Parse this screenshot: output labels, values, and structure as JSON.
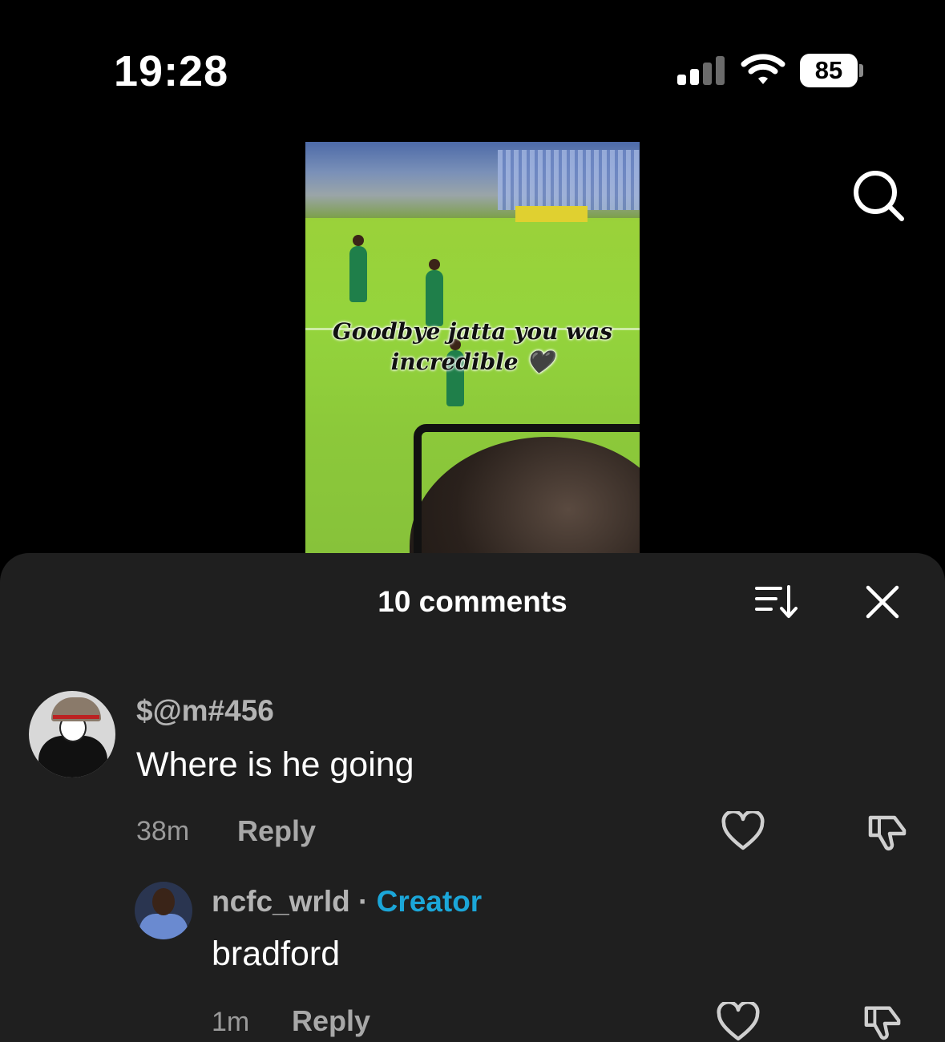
{
  "status_bar": {
    "time": "19:28",
    "battery": "85"
  },
  "video": {
    "caption_line1": "Goodbye jatta you was",
    "caption_line2": "incredible 🖤"
  },
  "comments_panel": {
    "title": "10 comments",
    "comments": [
      {
        "username": "$@m#456",
        "text": "Where is he going",
        "time": "38m",
        "reply_label": "Reply"
      },
      {
        "username": "ncfc_wrld",
        "separator": "·",
        "badge": "Creator",
        "text": "bradford",
        "time": "1m",
        "reply_label": "Reply"
      }
    ]
  },
  "colors": {
    "background": "#000000",
    "sheet": "#1f1f1f",
    "creator_accent": "#1ba6d8",
    "muted_text": "#9a9a9a"
  },
  "icons": [
    "search-icon",
    "sort-icon",
    "close-icon",
    "heart-icon",
    "dislike-icon",
    "signal-icon",
    "wifi-icon",
    "battery-icon"
  ]
}
